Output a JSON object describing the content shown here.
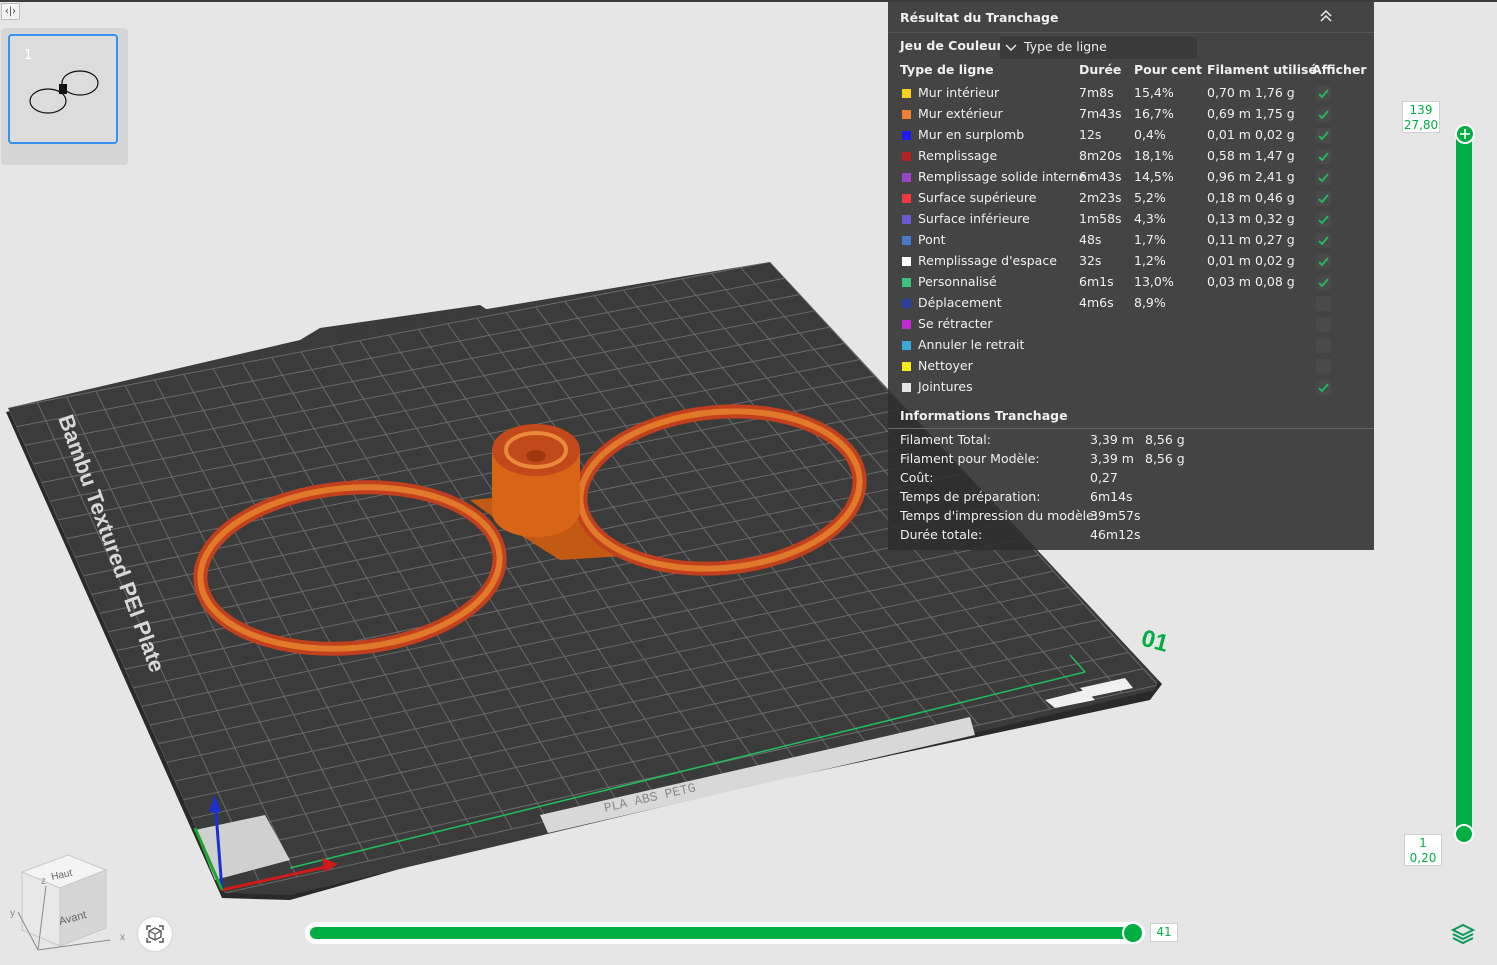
{
  "toolbar": {
    "collapse_icon": "collapse-sidebar-icon"
  },
  "plates": [
    {
      "index": "1"
    }
  ],
  "bed": {
    "label": "Bambu Textured PEI Plate",
    "strip_text": "PLA ABS PETG",
    "number": "01"
  },
  "panel": {
    "title": "Résultat du Tranchage",
    "color_set_label": "Jeu de Couleur",
    "color_set_value": "Type de ligne",
    "headers": {
      "type": "Type de ligne",
      "duration": "Durée",
      "percent": "Pour cent",
      "filament": "Filament utilisé",
      "show": "Afficher"
    },
    "rows": [
      {
        "color": "#f5d01e",
        "name": "Mur intérieur",
        "duration": "7m8s",
        "percent": "15,4%",
        "length": "0,70 m",
        "weight": "1,76 g",
        "shown": true
      },
      {
        "color": "#ef7f32",
        "name": "Mur extérieur",
        "duration": "7m43s",
        "percent": "16,7%",
        "length": "0,69 m",
        "weight": "1,75 g",
        "shown": true
      },
      {
        "color": "#1c1cf0",
        "name": "Mur en surplomb",
        "duration": "12s",
        "percent": "0,4%",
        "length": "0,01 m",
        "weight": "0,02 g",
        "shown": true
      },
      {
        "color": "#b02424",
        "name": "Remplissage",
        "duration": "8m20s",
        "percent": "18,1%",
        "length": "0,58 m",
        "weight": "1,47 g",
        "shown": true
      },
      {
        "color": "#9a45c8",
        "name": "Remplissage solide interne",
        "duration": "6m43s",
        "percent": "14,5%",
        "length": "0,96 m",
        "weight": "2,41 g",
        "shown": true
      },
      {
        "color": "#f03a3a",
        "name": "Surface supérieure",
        "duration": "2m23s",
        "percent": "5,2%",
        "length": "0,18 m",
        "weight": "0,46 g",
        "shown": true
      },
      {
        "color": "#6a5ad0",
        "name": "Surface inférieure",
        "duration": "1m58s",
        "percent": "4,3%",
        "length": "0,13 m",
        "weight": "0,32 g",
        "shown": true
      },
      {
        "color": "#4a78c8",
        "name": "Pont",
        "duration": "48s",
        "percent": "1,7%",
        "length": "0,11 m",
        "weight": "0,27 g",
        "shown": true
      },
      {
        "color": "#ffffff",
        "name": "Remplissage d'espace",
        "duration": "32s",
        "percent": "1,2%",
        "length": "0,01 m",
        "weight": "0,02 g",
        "shown": true
      },
      {
        "color": "#3cc27a",
        "name": "Personnalisé",
        "duration": "6m1s",
        "percent": "13,0%",
        "length": "0,03 m",
        "weight": "0,08 g",
        "shown": true
      },
      {
        "color": "#2a3ea0",
        "name": "Déplacement",
        "duration": "4m6s",
        "percent": "8,9%",
        "length": "",
        "weight": "",
        "shown": false
      },
      {
        "color": "#c02ad0",
        "name": "Se rétracter",
        "duration": "",
        "percent": "",
        "length": "",
        "weight": "",
        "shown": false
      },
      {
        "color": "#3aa8d8",
        "name": "Annuler le retrait",
        "duration": "",
        "percent": "",
        "length": "",
        "weight": "",
        "shown": false
      },
      {
        "color": "#f5e81c",
        "name": "Nettoyer",
        "duration": "",
        "percent": "",
        "length": "",
        "weight": "",
        "shown": false
      },
      {
        "color": "#e6e6e6",
        "name": "Jointures",
        "duration": "",
        "percent": "",
        "length": "",
        "weight": "",
        "shown": true
      }
    ],
    "info_title": "Informations Tranchage",
    "info": [
      {
        "label": "Filament Total:",
        "v1": "3,39 m",
        "v2": "8,56 g"
      },
      {
        "label": "Filament pour Modèle:",
        "v1": "3,39 m",
        "v2": "8,56 g"
      },
      {
        "label": "Coût:",
        "v1": "0,27",
        "v2": ""
      },
      {
        "label": "Temps de préparation:",
        "v1": "6m14s",
        "v2": ""
      },
      {
        "label": "Temps d'impression du modèle:",
        "v1": "39m57s",
        "v2": ""
      },
      {
        "label": "Durée totale:",
        "v1": "46m12s",
        "v2": ""
      }
    ]
  },
  "layer_slider": {
    "top_layer": "139",
    "top_height": "27,80",
    "bottom_layer": "1",
    "bottom_height": "0,20"
  },
  "move_slider": {
    "value": "41"
  },
  "view_cube": {
    "top": "Haut",
    "front": "Avant",
    "x": "x",
    "y": "y",
    "z": "z"
  },
  "colors": {
    "accent": "#00ae42",
    "panel_bg": "#2e2e2e",
    "model": "#e06a1c",
    "model_edge": "#c0392b",
    "bed": "#3b3b3b"
  }
}
